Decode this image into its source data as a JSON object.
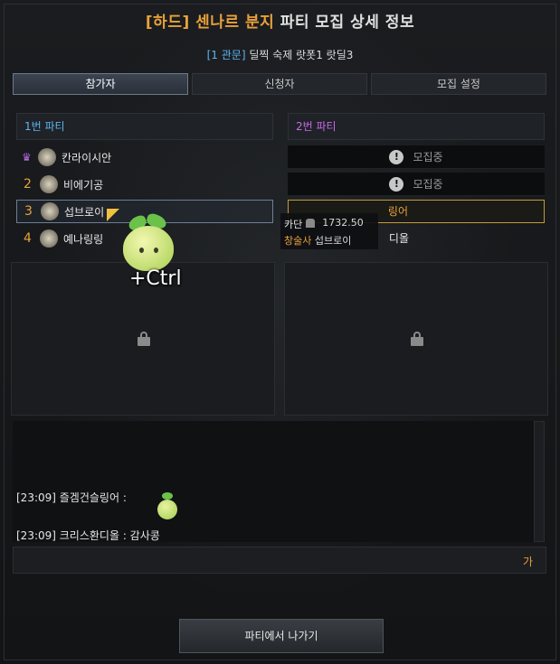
{
  "window": {
    "title_mode": "[하드]",
    "title_raid": "센나르 분지",
    "title_rest": "파티 모집 상세 정보",
    "subtitle_tag": "[1 관문]",
    "subtitle_text": "딜찍 숙제 랏폿1 랏딜3"
  },
  "tabs": [
    {
      "label": "참가자"
    },
    {
      "label": "신청자"
    },
    {
      "label": "모집 설정"
    }
  ],
  "party1": {
    "header": "1번 파티",
    "members": [
      {
        "num": "",
        "name": "칸라이시안",
        "leader": true
      },
      {
        "num": "2",
        "name": "비에기공"
      },
      {
        "num": "3",
        "name": "섭브로이"
      },
      {
        "num": "4",
        "name": "예나링링"
      }
    ]
  },
  "party2": {
    "header": "2번 파티",
    "slots": [
      {
        "status": "모집중"
      },
      {
        "status": "모집중"
      },
      {
        "name": "링어"
      },
      {
        "name": "디올"
      }
    ]
  },
  "tooltip": {
    "server": "카단",
    "item_level": "1732.50",
    "class": "창술사",
    "name": "섭브로이"
  },
  "chat": {
    "lines": [
      {
        "text": "[23:09] 즐겜건슬링어 :"
      },
      {
        "text": "[23:09] 크리스환디올 : 감사콩"
      }
    ],
    "ime_indicator": "가"
  },
  "leave_button": "파티에서 나가기",
  "overlay": {
    "hint": "+Ctrl"
  },
  "colors": {
    "accent_orange": "#e8a23a",
    "party1_blue": "#5fb4f0",
    "party2_purple": "#c86ae8"
  }
}
